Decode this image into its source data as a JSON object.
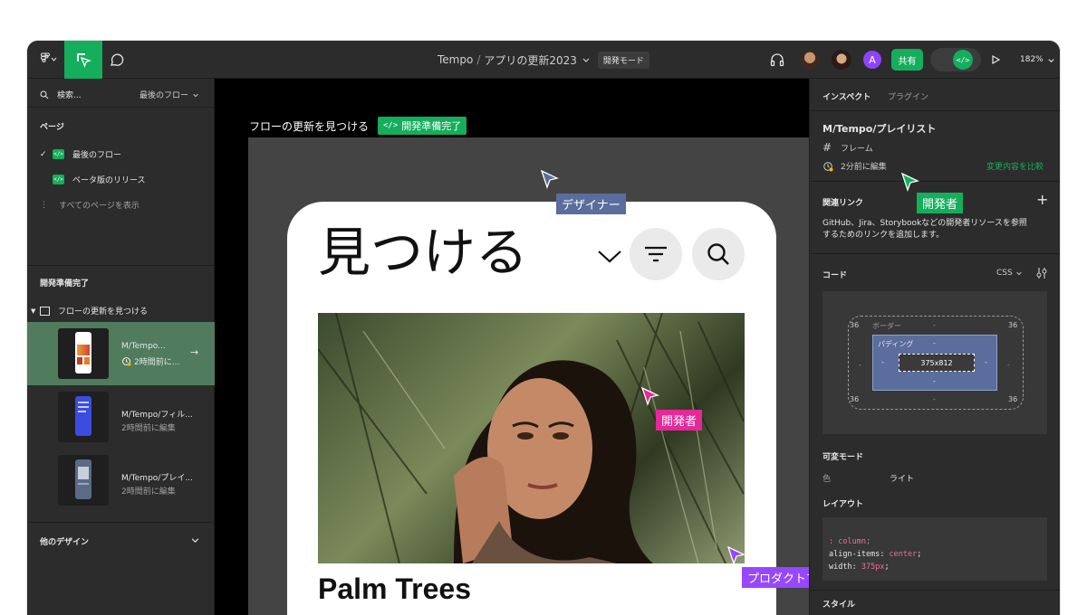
{
  "topbar": {
    "project": "Tempo",
    "separator": "/",
    "file": "アプリの更新2023",
    "mode_badge": "開発モード",
    "share_label": "共有",
    "avatar_letter": "A",
    "zoom": "182%"
  },
  "sidebar": {
    "search_label": "検索...",
    "flow_select": "最後のフロー",
    "pages_heading": "ページ",
    "pages": [
      {
        "label": "最後のフロー",
        "checked": true
      },
      {
        "label": "ベータ版のリリース",
        "checked": false
      }
    ],
    "show_all_pages": "すべてのページを表示",
    "ready_heading": "開発準備完了",
    "section_title": "フローの更新を見つける",
    "frames": [
      {
        "title": "M/Tempo...",
        "subtitle": "2時間前に...",
        "selected": true
      },
      {
        "title": "M/Tempo/フィル...",
        "subtitle": "2時間前に編集",
        "selected": false
      },
      {
        "title": "M/Tempo/プレイ...",
        "subtitle": "2時間前に編集",
        "selected": false
      }
    ],
    "other_designs": "他のデザイン"
  },
  "canvas": {
    "section_title": "フローの更新を見つける",
    "ready_badge": "開発準備完了",
    "phone": {
      "heading": "見つける",
      "card_title": "Palm Trees"
    },
    "cursors": {
      "designer": "デザイナー",
      "developer": "開発者",
      "pm": "プロダクトマネージャー",
      "developer_inspector": "開発者"
    }
  },
  "inspector": {
    "tabs": [
      "インスペクト",
      "プラグイン"
    ],
    "frame_name": "M/Tempo/プレイリスト",
    "frame_type": "フレーム",
    "edited": "2分前に編集",
    "compare": "変更内容を比較",
    "links_heading": "関連リンク",
    "links_desc_1": "GitHub、Jira、Storybookなどの開発者リソースを参照",
    "links_desc_2": "するためのリンクを追加します。",
    "code_heading": "コード",
    "code_lang": "CSS",
    "box": {
      "radius": "36",
      "border_label": "ボーダー",
      "padding_label": "パディング",
      "size": "375x812",
      "dash": "-"
    },
    "variable_mode_heading": "可変モード",
    "color_label": "色",
    "color_value": "ライト",
    "layout_heading": "レイアウト",
    "code_lines": [
      {
        "prop": "",
        "value": ": column;",
        "prefix": ""
      },
      {
        "prop": "align-items",
        "value": "center",
        "prefix": ""
      },
      {
        "prop": "width",
        "value": "375px",
        "prefix": ""
      }
    ],
    "style_heading": "スタイル"
  },
  "colors": {
    "accent_green": "#14ae5c",
    "designer_label": "#5a6d9c",
    "developer_pink": "#e5289a",
    "pm_purple": "#9747ff"
  }
}
